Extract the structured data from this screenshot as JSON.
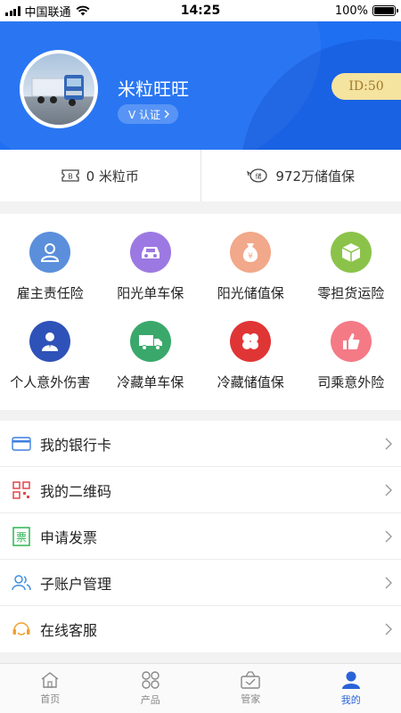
{
  "status_bar": {
    "carrier": "中国联通",
    "time": "14:25",
    "battery": "100%",
    "battery_level": 1.0
  },
  "profile": {
    "username": "米粒旺旺",
    "verify_label": "V 认证",
    "id_badge": "ID:50"
  },
  "stats": [
    {
      "icon": "ticket-icon",
      "label": "0 米粒币"
    },
    {
      "icon": "piggy-bank-icon",
      "label": "972万储值保"
    }
  ],
  "products": [
    {
      "label": "雇主责任险",
      "icon": "employer-icon",
      "color": "#5b8fdb"
    },
    {
      "label": "阳光单车保",
      "icon": "car-icon",
      "color": "#9c79e2"
    },
    {
      "label": "阳光储值保",
      "icon": "money-bag-icon",
      "color": "#f2a88a"
    },
    {
      "label": "零担货运险",
      "icon": "cargo-box-icon",
      "color": "#8bc34a"
    },
    {
      "label": "个人意外伤害",
      "icon": "person-icon",
      "color": "#2f52b8"
    },
    {
      "label": "冷藏单车保",
      "icon": "truck-icon",
      "color": "#3aa86b"
    },
    {
      "label": "冷藏储值保",
      "icon": "clover-icon",
      "color": "#e03535"
    },
    {
      "label": "司乘意外险",
      "icon": "thumbs-up-icon",
      "color": "#f47a86"
    }
  ],
  "menu": [
    {
      "label": "我的银行卡",
      "icon": "bank-card-icon",
      "color": "#3d7fe0"
    },
    {
      "label": "我的二维码",
      "icon": "qr-code-icon",
      "color": "#e0474c"
    },
    {
      "label": "申请发票",
      "icon": "invoice-icon",
      "color": "#2db552"
    },
    {
      "label": "子账户管理",
      "icon": "sub-account-icon",
      "color": "#3d8fe0"
    },
    {
      "label": "在线客服",
      "icon": "customer-service-icon",
      "color": "#f0a030"
    }
  ],
  "tabs": [
    {
      "label": "首页",
      "icon": "home-icon",
      "active": false
    },
    {
      "label": "产品",
      "icon": "product-icon",
      "active": false
    },
    {
      "label": "管家",
      "icon": "butler-icon",
      "active": false
    },
    {
      "label": "我的",
      "icon": "profile-icon",
      "active": true
    }
  ],
  "colors": {
    "header_bg": "#1f6ff2",
    "accent": "#2a63d8",
    "id_badge_bg": "#f5e3a0"
  }
}
